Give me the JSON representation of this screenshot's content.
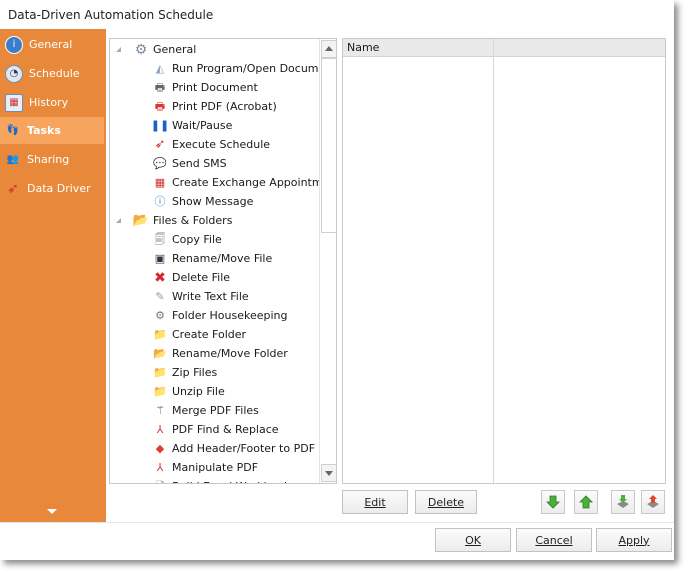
{
  "window": {
    "title": "Data-Driven Automation Schedule"
  },
  "sidebar": {
    "items": [
      {
        "label": "General",
        "icon": "info-icon",
        "active": false
      },
      {
        "label": "Schedule",
        "icon": "clock-icon",
        "active": false
      },
      {
        "label": "History",
        "icon": "calendar-clock-icon",
        "active": false
      },
      {
        "label": "Tasks",
        "icon": "footprints-add-icon",
        "active": true
      },
      {
        "label": "Sharing",
        "icon": "users-icon",
        "active": false
      },
      {
        "label": "Data Driver",
        "icon": "red-arrow-icon",
        "active": false
      }
    ],
    "more_icon": "chevron-down-icon"
  },
  "colors": {
    "sidebar": "#e8883a",
    "sidebar_active": "#f6a45e"
  },
  "task_tree": {
    "groups": [
      {
        "label": "General",
        "icon": "gear-icon",
        "items": [
          {
            "label": "Run Program/Open Document",
            "icon": "program-icon"
          },
          {
            "label": "Print Document",
            "icon": "printer-icon"
          },
          {
            "label": "Print PDF (Acrobat)",
            "icon": "print-pdf-icon"
          },
          {
            "label": "Wait/Pause",
            "icon": "pause-icon"
          },
          {
            "label": "Execute Schedule",
            "icon": "execute-icon"
          },
          {
            "label": "Send SMS",
            "icon": "sms-icon"
          },
          {
            "label": "Create Exchange Appointment",
            "icon": "appointment-icon"
          },
          {
            "label": "Show Message",
            "icon": "info-icon"
          }
        ]
      },
      {
        "label": "Files & Folders",
        "icon": "folder-icon",
        "items": [
          {
            "label": "Copy File",
            "icon": "copy-file-icon"
          },
          {
            "label": "Rename/Move File",
            "icon": "rename-file-icon"
          },
          {
            "label": "Delete File",
            "icon": "delete-icon"
          },
          {
            "label": "Write Text File",
            "icon": "write-text-icon"
          },
          {
            "label": "Folder Housekeeping",
            "icon": "housekeeping-icon"
          },
          {
            "label": "Create Folder",
            "icon": "create-folder-icon"
          },
          {
            "label": "Rename/Move Folder",
            "icon": "rename-folder-icon"
          },
          {
            "label": "Zip Files",
            "icon": "zip-icon"
          },
          {
            "label": "Unzip File",
            "icon": "unzip-icon"
          },
          {
            "label": "Merge PDF Files",
            "icon": "merge-pdf-icon"
          },
          {
            "label": "PDF Find & Replace",
            "icon": "pdf-icon"
          },
          {
            "label": "Add Header/Footer to PDF",
            "icon": "pdf-header-icon"
          },
          {
            "label": "Manipulate PDF",
            "icon": "pdf-icon"
          },
          {
            "label": "Build Excel Workbook",
            "icon": "excel-icon"
          }
        ]
      }
    ]
  },
  "task_list": {
    "columns": [
      "Name",
      ""
    ],
    "rows": []
  },
  "actions": {
    "edit": "Edit",
    "delete": "Delete",
    "move_down": "move-down-icon",
    "move_up": "move-up-icon",
    "import": "import-icon",
    "export": "export-icon"
  },
  "footer": {
    "ok": "OK",
    "cancel": "Cancel",
    "apply": "Apply"
  }
}
